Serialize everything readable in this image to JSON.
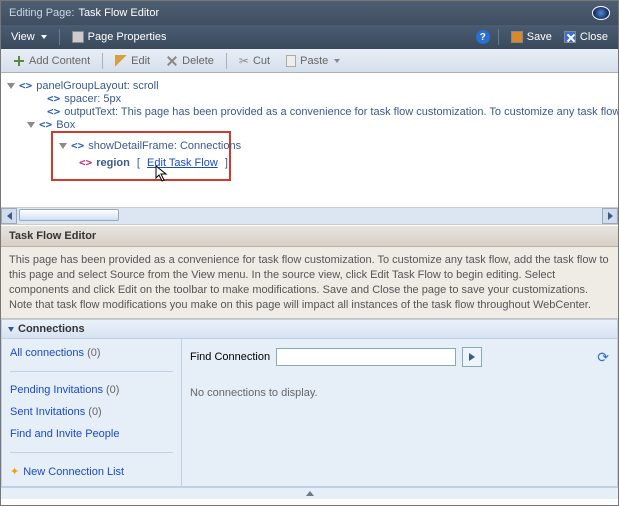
{
  "header": {
    "title_prefix": "Editing Page:",
    "title": "Task Flow Editor"
  },
  "toolbar1": {
    "view": "View",
    "page_properties": "Page Properties",
    "save": "Save",
    "close": "Close"
  },
  "toolbar2": {
    "add_content": "Add Content",
    "edit": "Edit",
    "delete": "Delete",
    "cut": "Cut",
    "paste": "Paste"
  },
  "tree": {
    "panelGroupLayout": "panelGroupLayout: scroll",
    "spacer": "spacer: 5px",
    "outputText": "outputText: This page has been provided as a convenience for task flow customization. To customize any task flow,",
    "box": "Box",
    "showDetailFrame": "showDetailFrame: Connections",
    "region": "region",
    "edit_task_flow": "Edit Task Flow"
  },
  "section": {
    "title": "Task Flow Editor",
    "desc": "This page has been provided as a convenience for task flow customization. To customize any task flow, add the task flow to this page and select Source from the View menu. In the source view, click Edit Task Flow to begin editing. Select components and click Edit on the toolbar to make modifications. Save and Close the page to save your customizations. Note that task flow modifications you make on this page will impact all instances of the task flow throughout WebCenter."
  },
  "connections": {
    "header": "Connections",
    "side": {
      "all": "All connections",
      "all_count": "(0)",
      "pending": "Pending Invitations",
      "pending_count": "(0)",
      "sent": "Sent Invitations",
      "sent_count": "(0)",
      "find_invite": "Find and Invite People",
      "new_list": "New Connection List"
    },
    "main": {
      "find_label": "Find Connection",
      "find_value": "",
      "empty": "No connections to display."
    }
  }
}
